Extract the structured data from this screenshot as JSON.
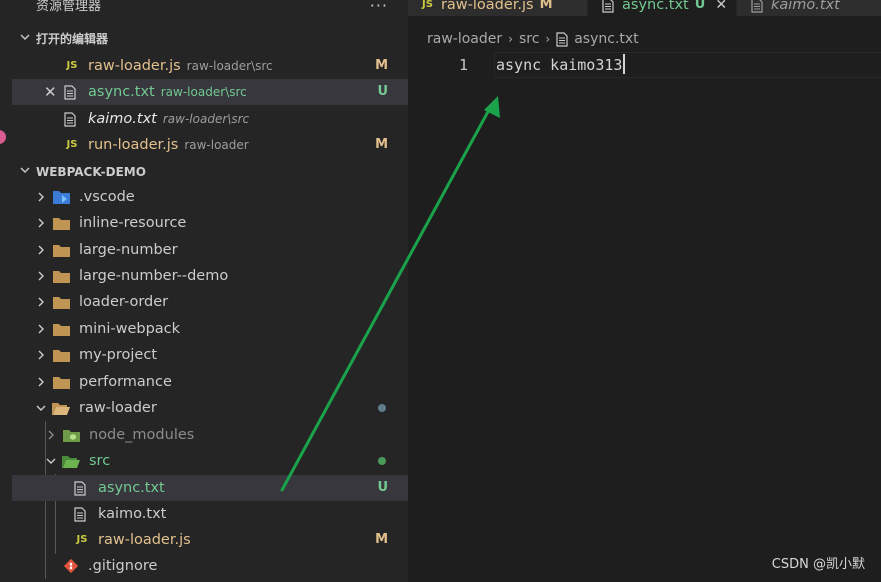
{
  "sidebar": {
    "title": "资源管理器",
    "more": "···",
    "open_editors": {
      "title": "打开的编辑器",
      "items": [
        {
          "icon": "JS",
          "name": "raw-loader.js",
          "path": "raw-loader\\src",
          "status": "M"
        },
        {
          "close": "✕",
          "name": "async.txt",
          "path": "raw-loader\\src",
          "status": "U"
        },
        {
          "name": "kaimo.txt",
          "path": "raw-loader\\src"
        },
        {
          "icon": "JS",
          "name": "run-loader.js",
          "path": "raw-loader",
          "status": "M"
        }
      ]
    },
    "project": {
      "title": "WEBPACK-DEMO",
      "items": [
        {
          "name": ".vscode"
        },
        {
          "name": "inline-resource"
        },
        {
          "name": "large-number"
        },
        {
          "name": "large-number--demo"
        },
        {
          "name": "loader-order"
        },
        {
          "name": "mini-webpack"
        },
        {
          "name": "my-project"
        },
        {
          "name": "performance"
        },
        {
          "name": "raw-loader"
        },
        {
          "name": "node_modules"
        },
        {
          "name": "src"
        },
        {
          "name": "async.txt",
          "status": "U"
        },
        {
          "name": "kaimo.txt"
        },
        {
          "icon": "JS",
          "name": "raw-loader.js",
          "status": "M"
        },
        {
          "name": ".gitignore"
        }
      ]
    }
  },
  "tabs": [
    {
      "icon": "JS",
      "name": "raw-loader.js",
      "status": "M"
    },
    {
      "name": "async.txt",
      "status": "U",
      "close": "✕"
    },
    {
      "name": "kaimo.txt"
    }
  ],
  "breadcrumb": {
    "parts": [
      "raw-loader",
      "src",
      "async.txt"
    ],
    "sep": "›"
  },
  "editor": {
    "line_number": "1",
    "code": "async kaimo313"
  },
  "watermark": "CSDN @凯小默",
  "colors": {
    "modified": "#e2c08d",
    "untracked": "#73c991",
    "folder": "#c09553",
    "js": "#cbcb41",
    "arrow": "#1aa34a",
    "ignored": "#8c8c8c"
  }
}
